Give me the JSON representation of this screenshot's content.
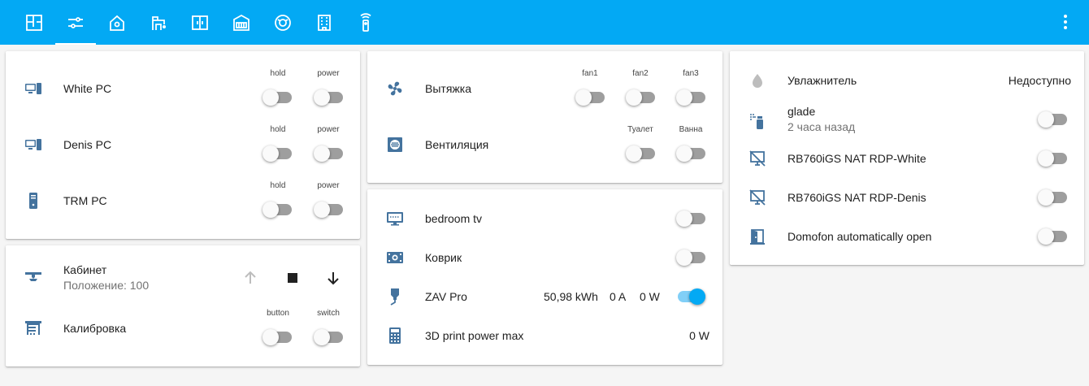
{
  "header": {
    "tabs": [
      {
        "icon": "floorplan-icon"
      },
      {
        "icon": "tune-icon"
      },
      {
        "icon": "home-icon"
      },
      {
        "icon": "crane-icon"
      },
      {
        "icon": "door-sliding-icon"
      },
      {
        "icon": "router-icon"
      },
      {
        "icon": "robot-vacuum-icon"
      },
      {
        "icon": "office-building-icon"
      },
      {
        "icon": "remote-icon"
      }
    ],
    "active_tab": 1,
    "menu_icon": "dots-vertical-icon"
  },
  "pcs": {
    "rows": [
      {
        "name": "White PC",
        "icon": "desktop-tower-monitor-icon",
        "hold_label": "hold",
        "power_label": "power",
        "hold": false,
        "power": false
      },
      {
        "name": "Denis PC",
        "icon": "desktop-tower-monitor-icon",
        "hold_label": "hold",
        "power_label": "power",
        "hold": false,
        "power": false
      },
      {
        "name": "TRM PC",
        "icon": "desktop-tower-icon",
        "hold_label": "hold",
        "power_label": "power",
        "hold": false,
        "power": false
      }
    ]
  },
  "cabinet": {
    "cover": {
      "name": "Кабинет",
      "state": "Положение: 100",
      "icon": "ceiling-light-icon"
    },
    "calibration": {
      "name": "Калибровка",
      "icon": "blinds-icon",
      "button_label": "button",
      "switch_label": "switch",
      "button": false,
      "switch": false
    }
  },
  "vent": {
    "hood": {
      "name": "Вытяжка",
      "icon": "fan-icon",
      "labels": [
        "fan1",
        "fan2",
        "fan3"
      ],
      "states": [
        false,
        false,
        false
      ]
    },
    "ventilation": {
      "name": "Вентиляция",
      "icon": "air-filter-icon",
      "labels": [
        "Туалет",
        "Ванна"
      ],
      "states": [
        false,
        false
      ]
    }
  },
  "devices": {
    "rows": [
      {
        "name": "bedroom tv",
        "icon": "television-icon",
        "on": false
      },
      {
        "name": "Коврик",
        "icon": "heating-mat-icon",
        "on": false
      },
      {
        "name": "ZAV Pro",
        "icon": "printer-3d-nozzle-icon",
        "energy": "50,98 kWh",
        "current": "0 A",
        "power": "0 W",
        "on": true
      },
      {
        "name": "3D print power max",
        "icon": "calculator-icon",
        "value": "0 W"
      }
    ]
  },
  "misc": {
    "humidifier": {
      "name": "Увлажнитель",
      "icon": "water-icon",
      "state": "Недоступно"
    },
    "rows": [
      {
        "name": "glade",
        "sub": "2 часа назад",
        "icon": "spray-icon",
        "on": false
      },
      {
        "name": "RB760iGS NAT RDP-White",
        "icon": "monitor-off-icon",
        "on": false
      },
      {
        "name": "RB760iGS NAT RDP-Denis",
        "icon": "monitor-off-icon",
        "on": false
      },
      {
        "name": "Domofon automatically open",
        "icon": "door-open-icon",
        "on": false
      }
    ]
  },
  "colors": {
    "accent": "#03a9f4",
    "icon": "#44739e",
    "background": "#f5f5f5"
  }
}
